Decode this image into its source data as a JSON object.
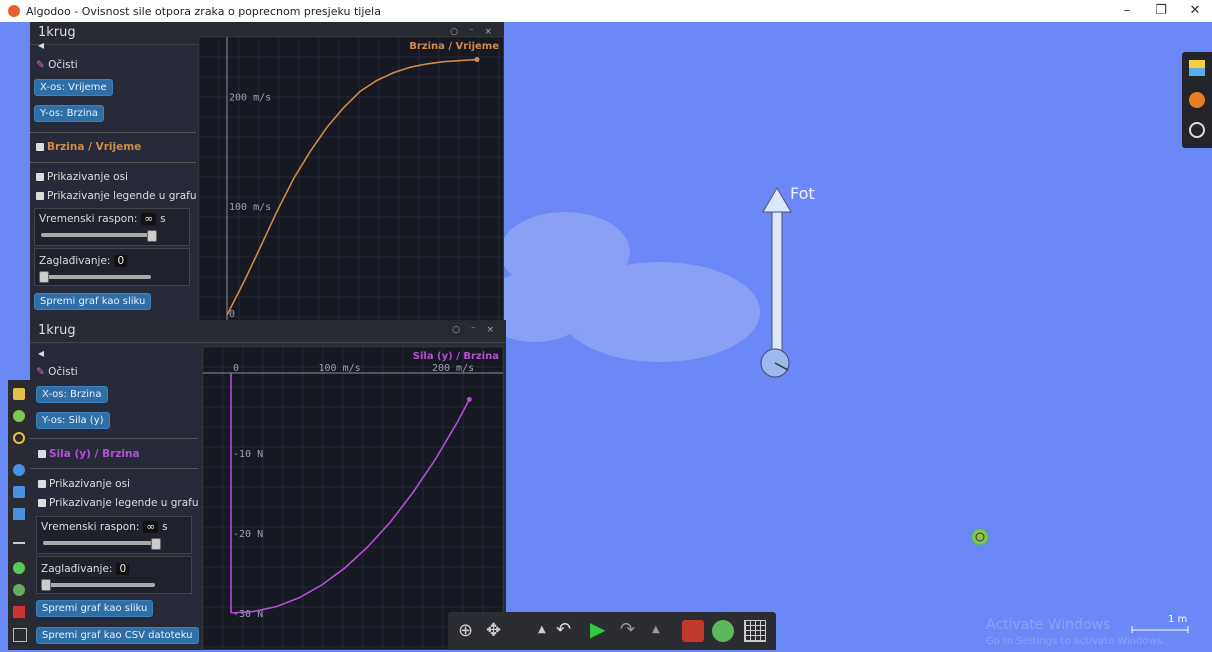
{
  "window": {
    "title": "Algodoo - Ovisnost sile otpora zraka o poprecnom presjeku tijela",
    "controls": [
      "–",
      "❐",
      "✕"
    ]
  },
  "scene": {
    "force_label": "Fot",
    "scale_label": "1 m",
    "watermark_line1": "Activate Windows",
    "watermark_line2": "Go to Settings to activate Windows."
  },
  "panel1": {
    "title": "1krug",
    "back": "◂",
    "clear": "Očisti",
    "x_axis_btn": "X-os: Vrijeme",
    "y_axis_btn": "Y-os: Brzina",
    "series_label": "Brzina / Vrijeme",
    "show_axes": "Prikazivanje osi",
    "show_legend": "Prikazivanje legende u grafu",
    "time_range_label": "Vremenski raspon:",
    "time_range_value": "∞",
    "time_unit": "s",
    "smoothing_label": "Zaglađivanje:",
    "smoothing_value": "0",
    "save_image_btn": "Spremi graf kao sliku",
    "graph_legend": "Brzina / Vrijeme",
    "y_ticks": [
      "200 m/s",
      "100 m/s",
      "0"
    ]
  },
  "panel2": {
    "title": "1krug",
    "back": "◂",
    "clear": "Očisti",
    "x_axis_btn": "X-os: Brzina",
    "y_axis_btn": "Y-os: Sila (y)",
    "series_label": "Sila (y) / Brzina",
    "show_axes": "Prikazivanje osi",
    "show_legend": "Prikazivanje legende u grafu",
    "time_range_label": "Vremenski raspon:",
    "time_range_value": "∞",
    "time_unit": "s",
    "smoothing_label": "Zaglađivanje:",
    "smoothing_value": "0",
    "save_image_btn": "Spremi graf kao sliku",
    "save_csv_btn": "Spremi graf kao CSV datoteku",
    "graph_legend": "Sila (y) / Brzina",
    "x_ticks": [
      "0",
      "100 m/s",
      "200 m/s"
    ],
    "y_ticks": [
      "-10 N",
      "-20 N",
      "-30 N"
    ]
  },
  "colors": {
    "scene_bg": "#6b88f7",
    "panel_bg": "#22242a",
    "button": "#2f6fa6",
    "series_orange": "#d08a4a",
    "series_purple": "#b44fd6"
  },
  "chart_data": [
    {
      "type": "line",
      "series": [
        {
          "name": "Brzina / Vrijeme",
          "x": [
            0,
            1,
            2,
            3,
            4,
            5,
            6,
            7,
            8,
            9,
            10,
            11,
            12,
            13,
            14,
            15
          ],
          "y": [
            0,
            30,
            62,
            95,
            125,
            150,
            172,
            190,
            205,
            215,
            222,
            227,
            230,
            232,
            233,
            234
          ]
        }
      ],
      "ylim": [
        0,
        240
      ],
      "yticks": [
        "100 m/s",
        "200 m/s"
      ]
    },
    {
      "type": "line",
      "series": [
        {
          "name": "Sila (y) / Brzina",
          "x": [
            0,
            20,
            40,
            60,
            80,
            100,
            120,
            140,
            160,
            180,
            200,
            210
          ],
          "y": [
            -30,
            -29.8,
            -29.2,
            -28.1,
            -26.5,
            -24.4,
            -21.8,
            -18.7,
            -15.0,
            -10.8,
            -6.0,
            -3.3
          ]
        }
      ],
      "xlim": [
        0,
        215
      ],
      "ylim": [
        -31,
        0
      ],
      "xticks": [
        "0",
        "100 m/s",
        "200 m/s"
      ],
      "yticks": [
        "-10 N",
        "-20 N",
        "-30 N"
      ]
    }
  ]
}
